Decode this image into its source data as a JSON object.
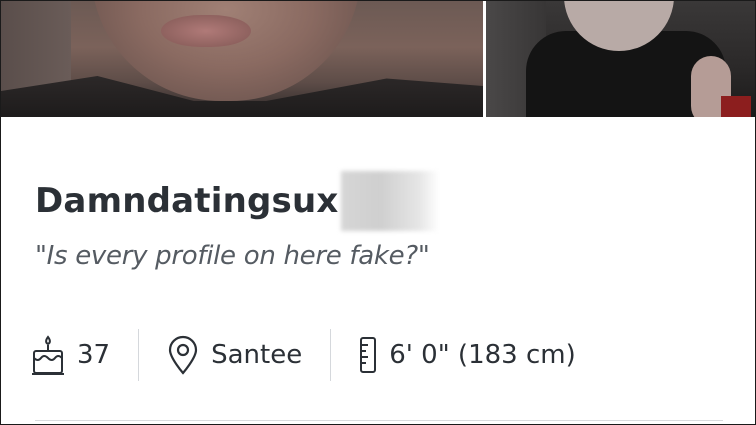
{
  "profile": {
    "username": "Damndatingsux",
    "tagline": "\"Is every profile on here fake?\""
  },
  "stats": {
    "age": "37",
    "location": "Santee",
    "height": "6' 0\" (183 cm)"
  },
  "icons": {
    "age": "birthday-cake-icon",
    "location": "location-pin-icon",
    "height": "ruler-icon"
  },
  "colors": {
    "text_primary": "#2b3036",
    "text_secondary": "#555b62",
    "divider": "#d5d8dc"
  }
}
